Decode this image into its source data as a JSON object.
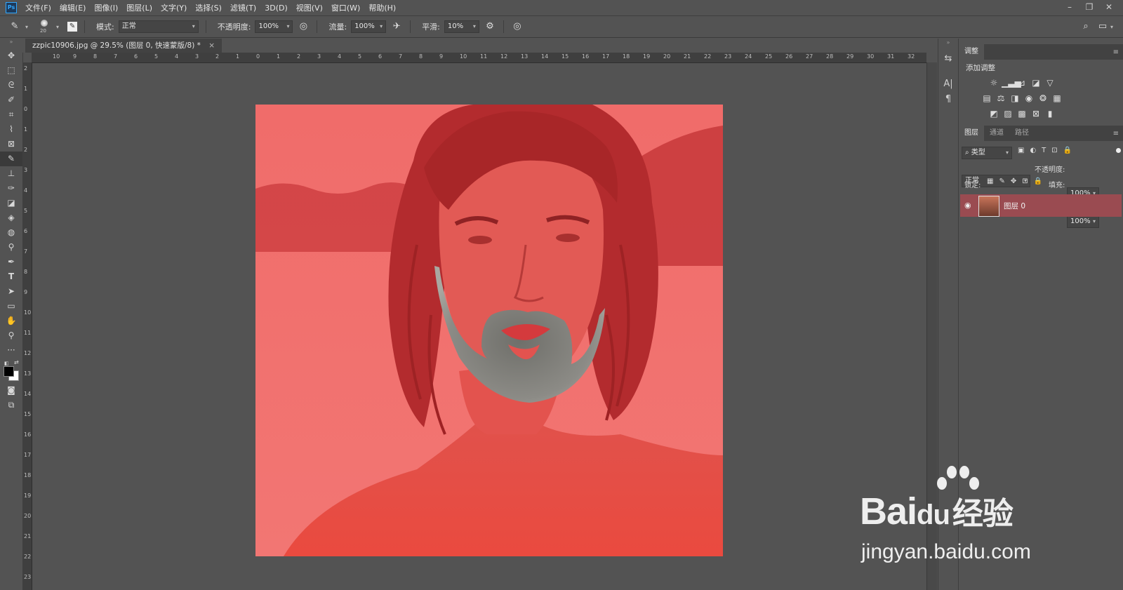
{
  "app": {
    "logo": "Ps"
  },
  "menu": [
    "文件(F)",
    "编辑(E)",
    "图像(I)",
    "图层(L)",
    "文字(Y)",
    "选择(S)",
    "滤镜(T)",
    "3D(D)",
    "视图(V)",
    "窗口(W)",
    "帮助(H)"
  ],
  "options": {
    "brush_size": "20",
    "mode_label": "模式:",
    "mode_value": "正常",
    "opacity_label": "不透明度:",
    "opacity_value": "100%",
    "flow_label": "流量:",
    "flow_value": "100%",
    "smooth_label": "平滑:",
    "smooth_value": "10%"
  },
  "document": {
    "tab_title": "zzpic10906.jpg @ 29.5% (图层 0, 快速蒙版/8) *",
    "close": "×"
  },
  "ruler": {
    "h_labels": [
      "10",
      "9",
      "8",
      "7",
      "6",
      "5",
      "4",
      "3",
      "2",
      "1",
      "0",
      "1",
      "2",
      "3",
      "4",
      "5",
      "6",
      "7",
      "8",
      "9",
      "10",
      "11",
      "12",
      "13",
      "14",
      "15",
      "16",
      "17",
      "18",
      "19",
      "20",
      "21",
      "22",
      "23",
      "24",
      "25",
      "26",
      "27",
      "28",
      "29",
      "30",
      "31",
      "32",
      "33"
    ],
    "v_labels": [
      "2",
      "1",
      "0",
      "1",
      "2",
      "3",
      "4",
      "5",
      "6",
      "7",
      "8",
      "9",
      "10",
      "11",
      "12",
      "13",
      "14",
      "15",
      "16",
      "17",
      "18",
      "19",
      "20",
      "21",
      "22",
      "23"
    ]
  },
  "adjustments": {
    "tab": "调整",
    "title": "添加调整"
  },
  "layers": {
    "tabs": [
      "图层",
      "通道",
      "路径"
    ],
    "filter": "类型",
    "blend": "正常",
    "opacity_label": "不透明度:",
    "opacity_value": "100%",
    "lock_label": "锁定:",
    "fill_label": "填充:",
    "fill_value": "100%",
    "layer_name": "图层 0"
  },
  "watermark": {
    "brand": "Bai",
    "brand2": "du",
    "jingyan": "经验",
    "url": "jingyan.baidu.com"
  },
  "colors": {
    "quickmask": "#ee5a58",
    "selected_layer": "#9a4b51",
    "accent": "#31a8ff"
  }
}
